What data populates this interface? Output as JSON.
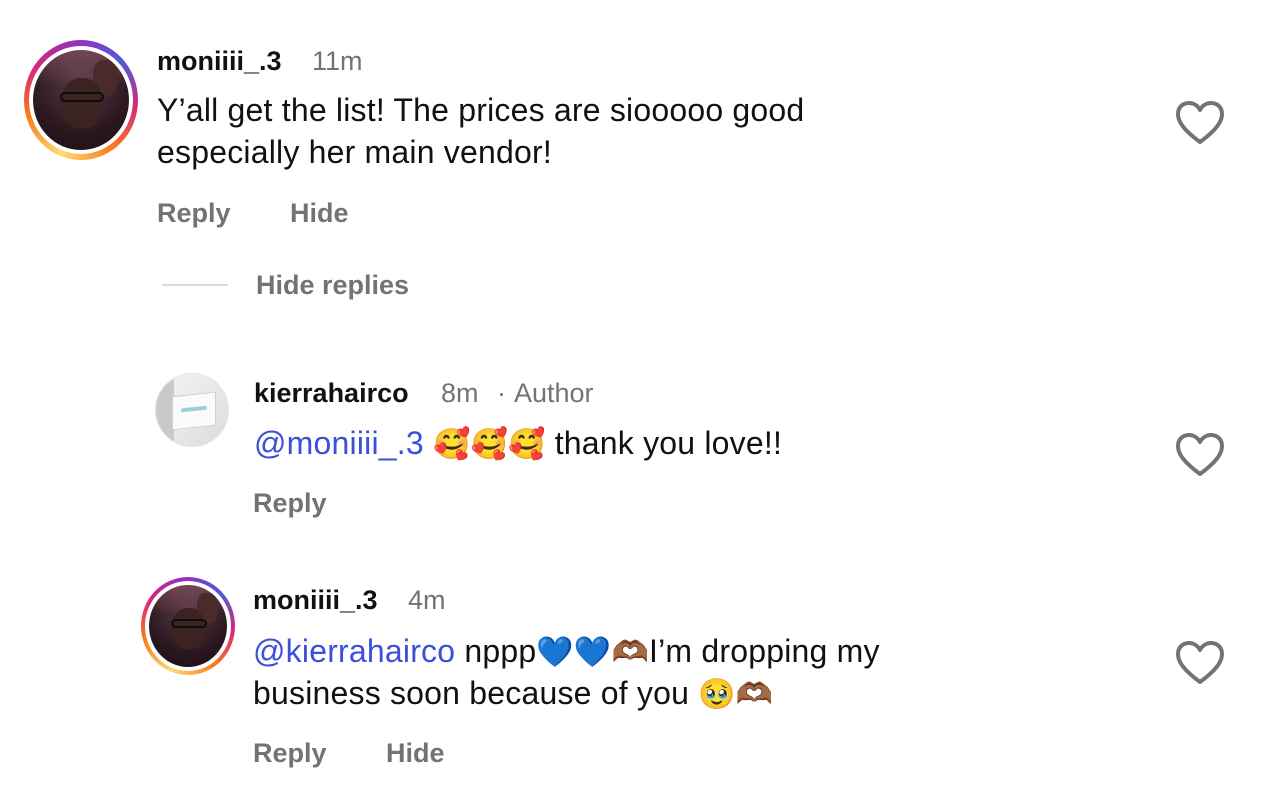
{
  "comments": [
    {
      "username": "moniiii_.3",
      "time": "11m",
      "text_line1": "Y’all get the list! The prices are siooooo good",
      "text_line2": "especially her main vendor!",
      "reply_label": "Reply",
      "hide_label": "Hide",
      "toggle_replies_label": "Hide replies"
    }
  ],
  "replies": [
    {
      "username": "kierrahairco",
      "time": "8m",
      "separator": "·",
      "badge": "Author",
      "mention": "@moniiii_.3",
      "emojis": "🥰🥰🥰",
      "text": "thank you love!!",
      "reply_label": "Reply"
    },
    {
      "username": "moniiii_.3",
      "time": "4m",
      "mention": "@kierrahairco",
      "text_part1": "nppp",
      "emojis1": "💙💙🫶🏾",
      "text_part2": "I’m dropping my",
      "text_line2": "business soon because of you",
      "emojis2": "🥹🫶🏾",
      "reply_label": "Reply",
      "hide_label": "Hide"
    }
  ],
  "icons": {
    "like": "heart-outline-icon"
  },
  "colors": {
    "mention": "#3b4fd8",
    "secondary_text": "#737373",
    "primary_text": "#111111",
    "divider": "#dbdbdb"
  }
}
